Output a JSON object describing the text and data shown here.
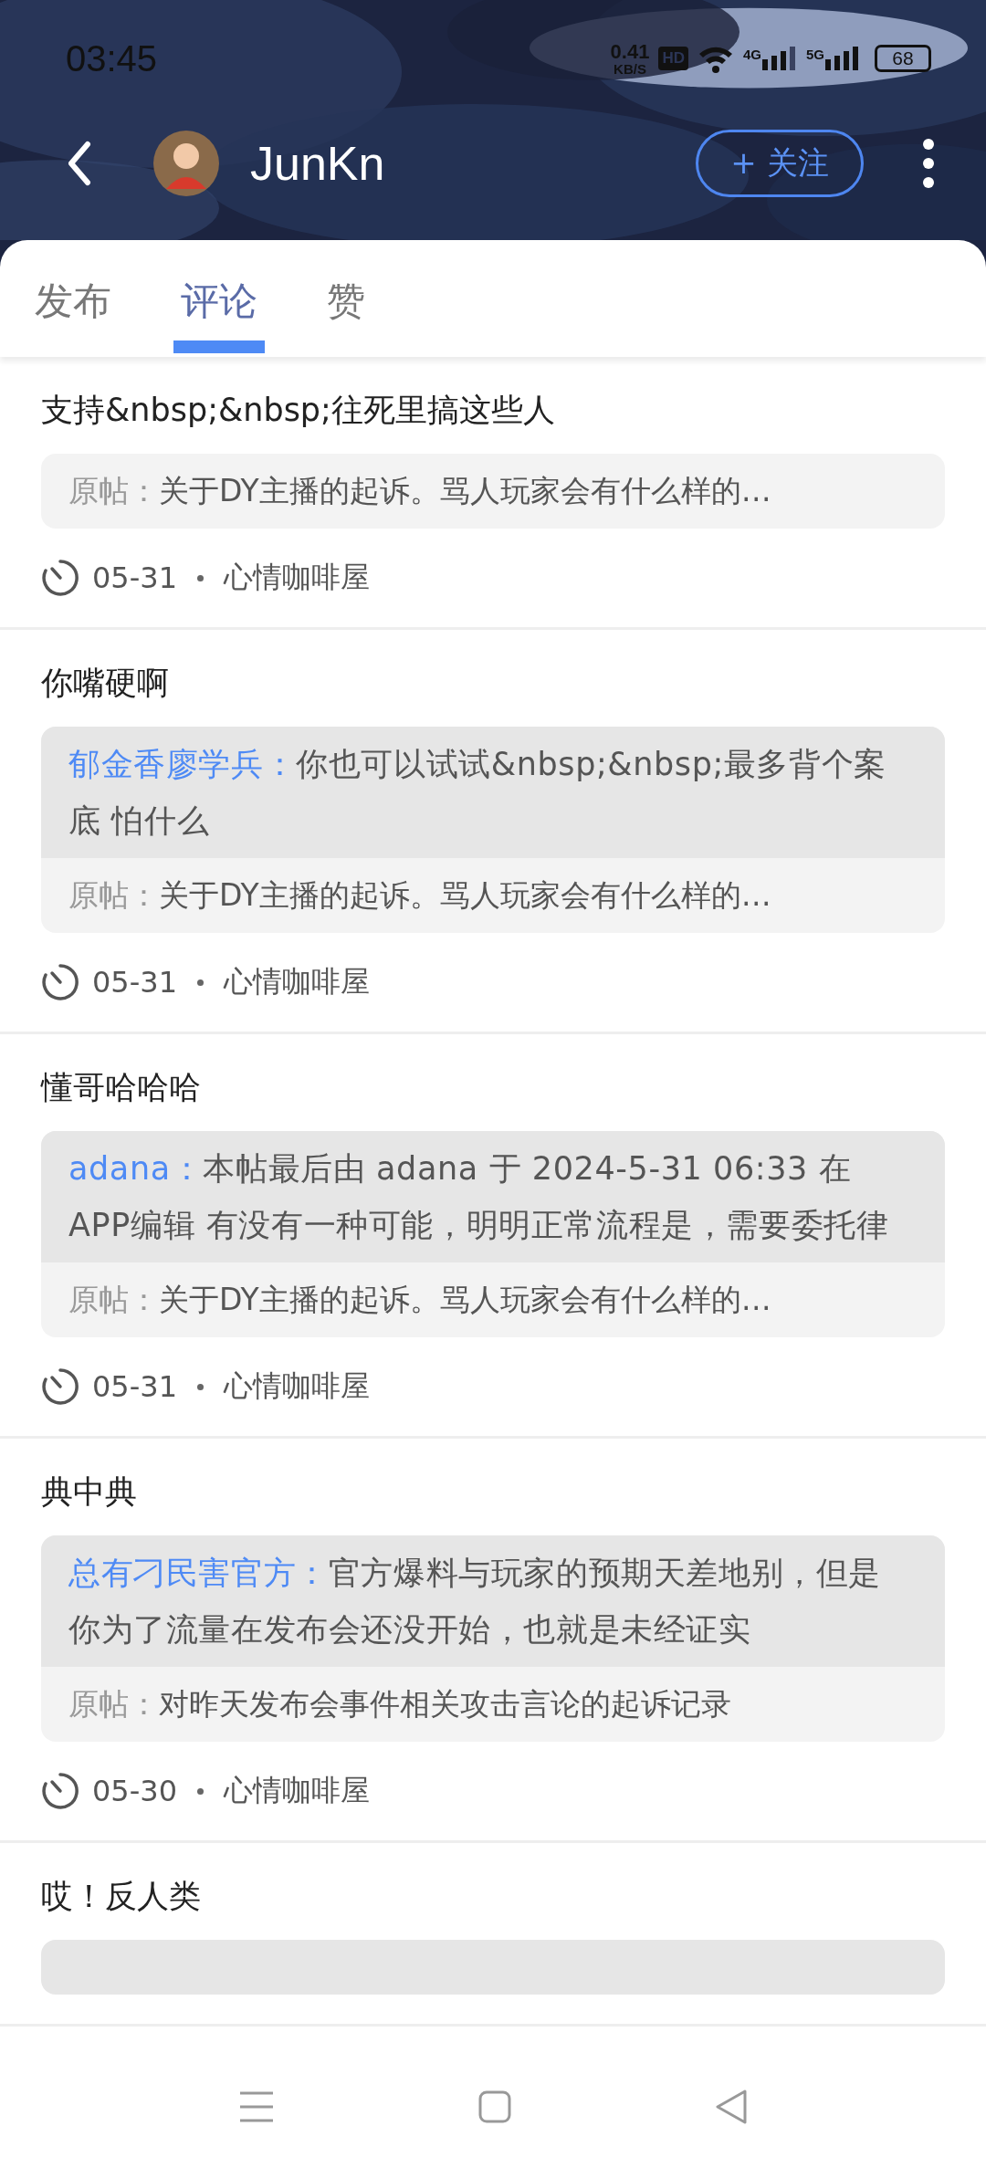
{
  "status_bar": {
    "time": "03:45",
    "net_speed": "0.41",
    "net_unit": "KB/S",
    "hd": "HD",
    "signals": [
      "4G",
      "5G"
    ],
    "battery": "68"
  },
  "header": {
    "name": "JunKn",
    "follow": "+ 关注"
  },
  "tabs": [
    {
      "label": "发布",
      "selected": false
    },
    {
      "label": "评论",
      "selected": true
    },
    {
      "label": "赞",
      "selected": false
    }
  ],
  "comments": [
    {
      "text": "支持&nbsp;&nbsp;往死里搞这些人",
      "original_label": "原帖：",
      "original": "关于DY主播的起诉。骂人玩家会有什么样的…",
      "date": "05-31",
      "forum": "心情咖啡屋"
    },
    {
      "text": "你嘴硬啊",
      "reply": {
        "author": "郁金香廖学兵：",
        "text": "你也可以试试&nbsp;&nbsp;最多背个案底 怕什么"
      },
      "original_label": "原帖：",
      "original": "关于DY主播的起诉。骂人玩家会有什么样的…",
      "date": "05-31",
      "forum": "心情咖啡屋"
    },
    {
      "text": "懂哥哈哈哈",
      "reply": {
        "author": "adana：",
        "text": "本帖最后由 adana 于 2024-5-31 06:33 在APP编辑 有没有一种可能，明明正常流程是，需要委托律"
      },
      "original_label": "原帖：",
      "original": "关于DY主播的起诉。骂人玩家会有什么样的…",
      "date": "05-31",
      "forum": "心情咖啡屋"
    },
    {
      "text": "典中典",
      "reply": {
        "author": "总有刁民害官方：",
        "text": "官方爆料与玩家的预期天差地别，但是你为了流量在发布会还没开始，也就是未经证实"
      },
      "original_label": "原帖：",
      "original": "对昨天发布会事件相关攻击言论的起诉记录",
      "date": "05-30",
      "forum": "心情咖啡屋"
    },
    {
      "text": "哎！反人类",
      "clipped": true
    }
  ]
}
